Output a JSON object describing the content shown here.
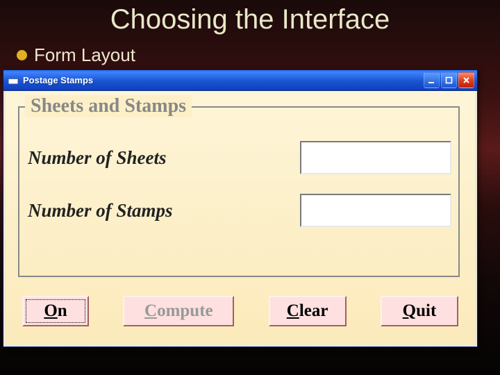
{
  "slide": {
    "title": "Choosing the Interface",
    "bullet": "Form Layout"
  },
  "window": {
    "title": "Postage Stamps"
  },
  "group": {
    "legend": "Sheets and Stamps",
    "fields": {
      "sheets": {
        "label": "Number of Sheets",
        "value": ""
      },
      "stamps": {
        "label": "Number of Stamps",
        "value": ""
      }
    }
  },
  "buttons": {
    "on": {
      "underline": "O",
      "rest": "n",
      "enabled": true,
      "focused": true
    },
    "compute": {
      "underline": "C",
      "rest": "ompute",
      "enabled": false,
      "focused": false
    },
    "clear": {
      "underline": "C",
      "rest": "lear",
      "enabled": true,
      "focused": false
    },
    "quit": {
      "underline": "Q",
      "rest": "uit",
      "enabled": true,
      "focused": false
    }
  }
}
